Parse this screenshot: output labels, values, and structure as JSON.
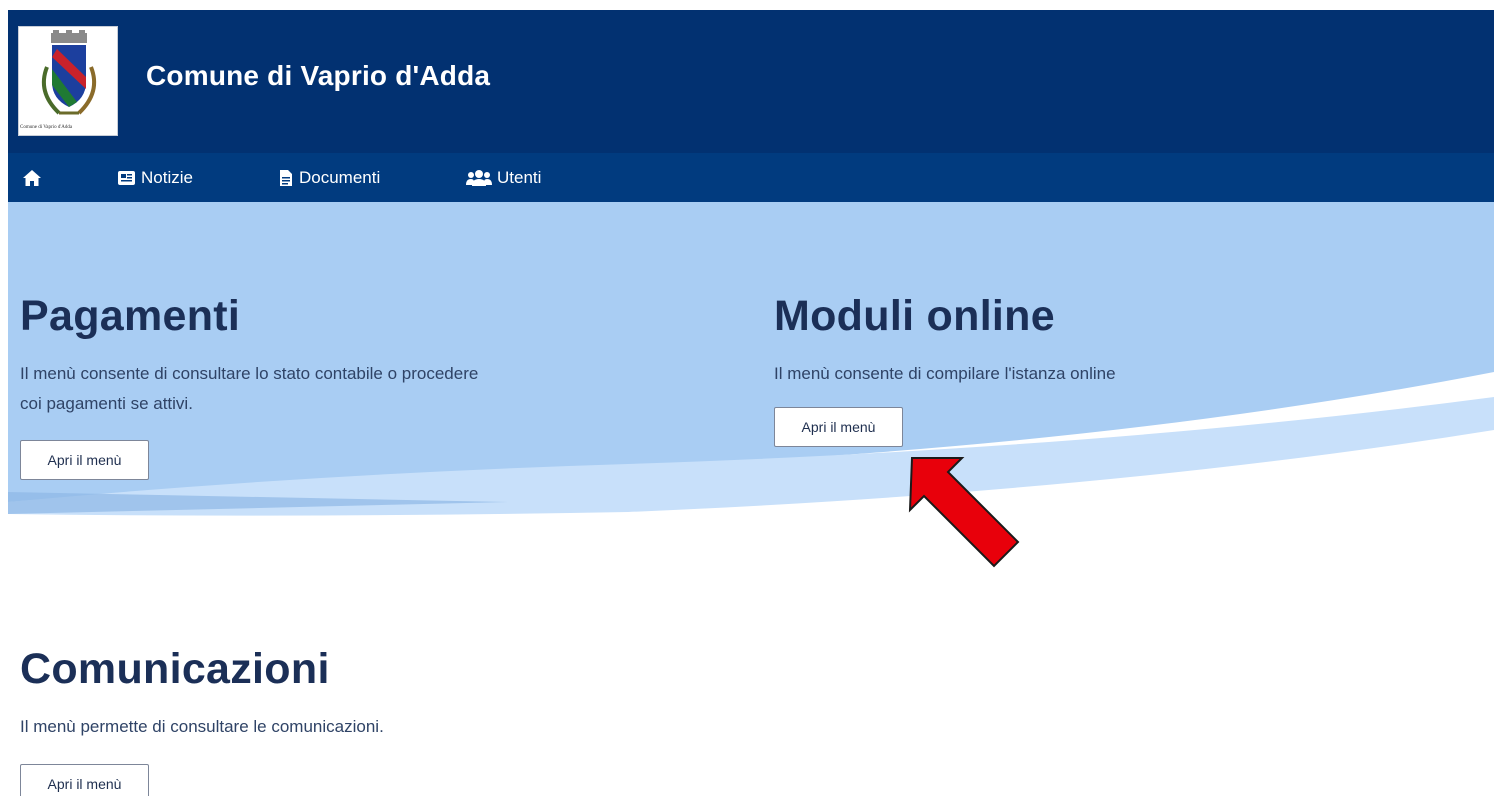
{
  "header": {
    "title": "Comune di Vaprio d'Adda",
    "logo_caption": "Comune di Vaprio d'Adda"
  },
  "nav": {
    "items": [
      {
        "label": "",
        "icon": "home-icon"
      },
      {
        "label": "Notizie",
        "icon": "newspaper-icon"
      },
      {
        "label": "Documenti",
        "icon": "document-icon"
      },
      {
        "label": "Utenti",
        "icon": "users-icon"
      }
    ]
  },
  "sections": {
    "pagamenti": {
      "title": "Pagamenti",
      "description_line1": "Il menù consente di consultare lo stato contabile o procedere",
      "description_line2": "coi pagamenti se attivi.",
      "button": "Apri il menù"
    },
    "moduli": {
      "title": "Moduli online",
      "description": "Il menù consente di compilare l'istanza online",
      "button": "Apri il menù"
    },
    "comunicazioni": {
      "title": "Comunicazioni",
      "description": "Il menù permette di consultare le comunicazioni.",
      "button": "Apri il menù"
    }
  },
  "colors": {
    "header_bg": "#023171",
    "nav_bg": "#013b7f",
    "hero_bg": "#a9cdf3",
    "title_text": "#1b2f57",
    "annotation_arrow": "#e8000b"
  }
}
